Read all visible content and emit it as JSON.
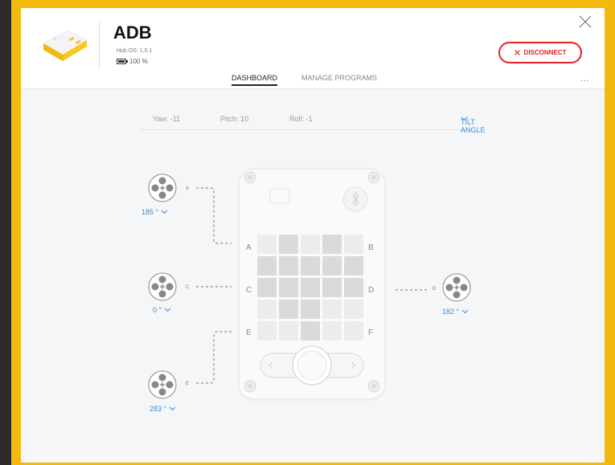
{
  "hub": {
    "name": "ADB",
    "os": "Hub OS: 1.0.1",
    "battery": "100 %",
    "battery_level": 1.0
  },
  "tabs": [
    {
      "label": "DASHBOARD"
    },
    {
      "label": "MANAGE PROGRAMS"
    }
  ],
  "actions": {
    "disconnect": "DISCONNECT",
    "more": "..."
  },
  "tilt": {
    "yaw": "Yaw: -11",
    "pitch": "Pitch: 10",
    "roll": "Roll: -1",
    "mode": "TILT ANGLE"
  },
  "ports": {
    "A": {
      "letter": "A",
      "value": "185 °"
    },
    "C": {
      "letter": "C",
      "value": "0 °"
    },
    "E": {
      "letter": "E",
      "value": "283 °"
    },
    "D": {
      "letter": "D",
      "value": "182 °"
    }
  },
  "hub_sides": {
    "A": "A",
    "B": "B",
    "C": "C",
    "D": "D",
    "E": "E",
    "F": "F"
  },
  "matrix": [
    [
      1,
      2,
      1,
      2,
      1
    ],
    [
      2,
      2,
      2,
      2,
      2
    ],
    [
      2,
      2,
      2,
      2,
      2
    ],
    [
      1,
      2,
      2,
      1,
      1
    ],
    [
      1,
      1,
      2,
      1,
      1
    ]
  ],
  "colors": {
    "accent": "#3b8fde",
    "danger": "#e12126",
    "pixel_off": "#ececec",
    "pixel_on": "#dadada"
  }
}
